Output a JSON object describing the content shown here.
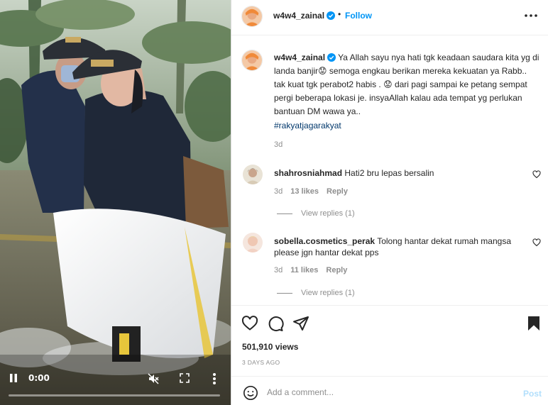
{
  "post": {
    "author": "w4w4_zainal",
    "follow_label": "Follow",
    "separator": "•",
    "caption_text": "Ya Allah sayu nya hati tgk keadaan saudara kita yg di landa banjir😟 semoga engkau berikan mereka kekuatan ya Rabb.. tak kuat tgk perabot2 habis . 😟 dari pagi sampai ke petang sempat pergi beberapa lokasi je. insyaAllah kalau ada tempat yg perlukan bantuan DM wawa ya..",
    "hashtag": "#rakyatjagarakyat",
    "caption_age": "3d",
    "views": "501,910 views",
    "posted": "3 DAYS AGO"
  },
  "video": {
    "time": "0:00",
    "progress": 0.0,
    "icons": {
      "play": "pause-icon",
      "mute": "muted-speaker-icon",
      "fullscreen": "fullscreen-icon",
      "more": "more-vertical-icon"
    }
  },
  "comments": [
    {
      "username": "shahrosniahmad",
      "text": "Hati2 bru lepas bersalin",
      "age": "3d",
      "likes": "13 likes",
      "reply_label": "Reply",
      "view_replies": "View replies (1)"
    },
    {
      "username": "sobella.cosmetics_perak",
      "text": "Tolong hantar dekat rumah mangsa please jgn hantar dekat pps",
      "age": "3d",
      "likes": "11 likes",
      "reply_label": "Reply",
      "view_replies": "View replies (1)"
    }
  ],
  "add_comment": {
    "placeholder": "Add a comment...",
    "post_label": "Post"
  },
  "colors": {
    "accent": "#0095f6",
    "hashtag": "#00376b",
    "muted": "#8e8e8e",
    "post_disabled": "#b2dffc"
  }
}
